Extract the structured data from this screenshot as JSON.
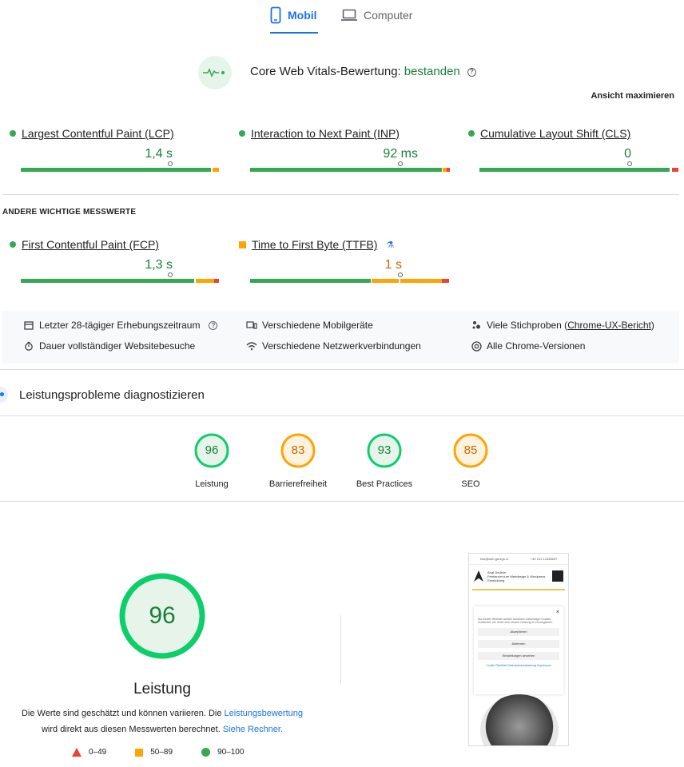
{
  "tabs": [
    {
      "label": "Mobil",
      "icon": "smartphone-icon",
      "active": true
    },
    {
      "label": "Computer",
      "icon": "laptop-icon",
      "active": false
    }
  ],
  "cwv": {
    "title": "Core Web Vitals-Bewertung:",
    "status": "bestanden",
    "maximize_label": "Ansicht maximieren"
  },
  "core_metrics": [
    {
      "name": "Largest Contentful Paint (LCP)",
      "value": "1,4 s",
      "status": "good"
    },
    {
      "name": "Interaction to Next Paint (INP)",
      "value": "92 ms",
      "status": "good"
    },
    {
      "name": "Cumulative Layout Shift (CLS)",
      "value": "0",
      "status": "good"
    }
  ],
  "other_metrics": {
    "section_label": "ANDERE WICHTIGE MESSWERTE",
    "items": [
      {
        "name": "First Contentful Paint (FCP)",
        "value": "1,3 s",
        "status": "good"
      },
      {
        "name": "Time to First Byte (TTFB)",
        "value": "1 s",
        "status": "needs-improvement",
        "experimental": true
      }
    ]
  },
  "info": {
    "period": "Letzter 28-tägiger Erhebungszeitraum",
    "devices": "Verschiedene Mobilgeräte",
    "samples_prefix": "Viele Stichproben (",
    "samples_link": "Chrome-UX-Bericht",
    "samples_suffix": ")",
    "duration": "Dauer vollständiger Websitebesuche",
    "network": "Verschiedene Netzwerkverbindungen",
    "versions": "Alle Chrome-Versionen"
  },
  "diagnose": {
    "title": "Leistungsprobleme diagnostizieren"
  },
  "scores": [
    {
      "value": 96,
      "label": "Leistung",
      "color": "#0cce6b",
      "text_color": "#188038",
      "fill": "#e6f4ea"
    },
    {
      "value": 83,
      "label": "Barrierefreiheit",
      "color": "#ffa400",
      "text_color": "#c26a00",
      "fill": "#fff3e0"
    },
    {
      "value": 93,
      "label": "Best Practices",
      "color": "#0cce6b",
      "text_color": "#188038",
      "fill": "#e6f4ea"
    },
    {
      "value": 85,
      "label": "SEO",
      "color": "#ffa400",
      "text_color": "#c26a00",
      "fill": "#fff3e0"
    }
  ],
  "performance": {
    "score": "96",
    "title": "Leistung",
    "desc_part1": "Die Werte sind geschätzt und können variieren. Die ",
    "desc_link1": "Leistungsbewertung",
    "desc_part2": "wird direkt aus diesen Messwerten berechnet. ",
    "desc_link2": "Siehe Rechner."
  },
  "legend": [
    {
      "range": "0–49",
      "shape": "triangle",
      "color": "#ea4335"
    },
    {
      "range": "50–89",
      "shape": "square",
      "color": "#ffa400"
    },
    {
      "range": "90–100",
      "shape": "circle",
      "color": "#34a853"
    }
  ],
  "thumbnail": {
    "topbar_left": "info@web.gerzgn.ct",
    "topbar_right": "+49 151 12345697",
    "site_name": "Arial Gedeon",
    "site_tagline": "Freelancer fuer Webdesign & Wordpress Entwicklung",
    "modal_text": "Auf meiner Website werden technisch notwendige Cookies verwendet, um ihnen eine sichere Nutzung zu ermoeglichen.",
    "btn_accept": "Akzeptieren",
    "btn_decline": "Ablehnen",
    "btn_settings": "Einstellungen ansehen",
    "links": "Cookie Richtlinie  Datenschutzerklaerung  Impressum"
  },
  "colors": {
    "accent": "#1a73e8",
    "good": "#34a853",
    "average": "#ffa400",
    "poor": "#ea4335"
  }
}
